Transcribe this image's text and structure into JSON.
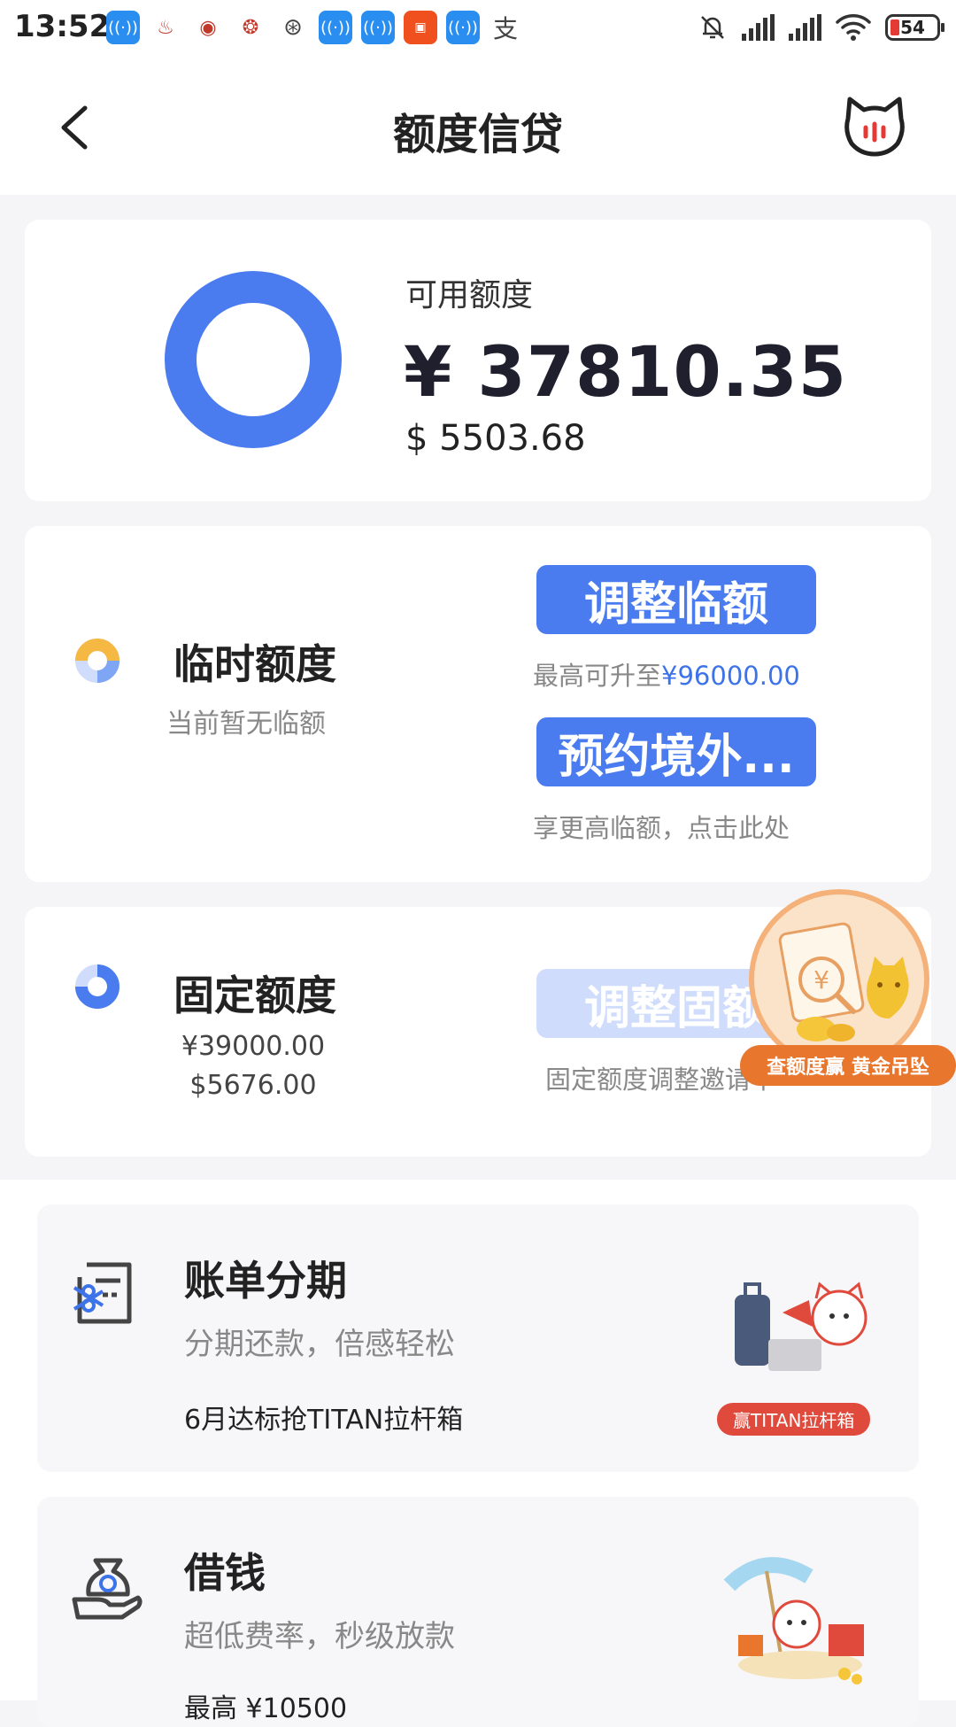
{
  "status_bar": {
    "time": "13:52",
    "battery": "54",
    "notification_icons": [
      "wifi-app-icon",
      "app-icon",
      "app-icon",
      "app-icon",
      "app-icon",
      "wifi-app-icon",
      "wifi-app-icon",
      "app-icon",
      "wifi-app-icon",
      "alipay-icon"
    ]
  },
  "header": {
    "title": "额度信贷"
  },
  "available": {
    "label": "可用额度",
    "cny": "¥ 37810.35",
    "usd": "$ 5503.68"
  },
  "temporary": {
    "title": "临时额度",
    "subtitle": "当前暂无临额",
    "adjust_button": "调整临额",
    "adjust_hint_prefix": "最高可升至",
    "adjust_hint_amount": "¥96000.00",
    "overseas_button": "预约境外...",
    "overseas_hint": "享更高临额，点击此处"
  },
  "fixed": {
    "title": "固定额度",
    "cny": "¥39000.00",
    "usd": "$5676.00",
    "adjust_button": "调整固额",
    "adjust_hint": "固定额度调整邀请中"
  },
  "promo": {
    "banner": "查额度赢 黄金吊坠"
  },
  "features": [
    {
      "title": "账单分期",
      "subtitle": "分期还款，倍感轻松",
      "note": "6月达标抢TITAN拉杆箱",
      "art_tag": "赢TITAN拉杆箱"
    },
    {
      "title": "借钱",
      "subtitle": "超低费率，秒级放款",
      "note": "最高 ¥10500"
    }
  ],
  "colors": {
    "accent": "#4a7cf0",
    "accent_light": "#cfdcfb",
    "promo_orange": "#e8762c"
  }
}
